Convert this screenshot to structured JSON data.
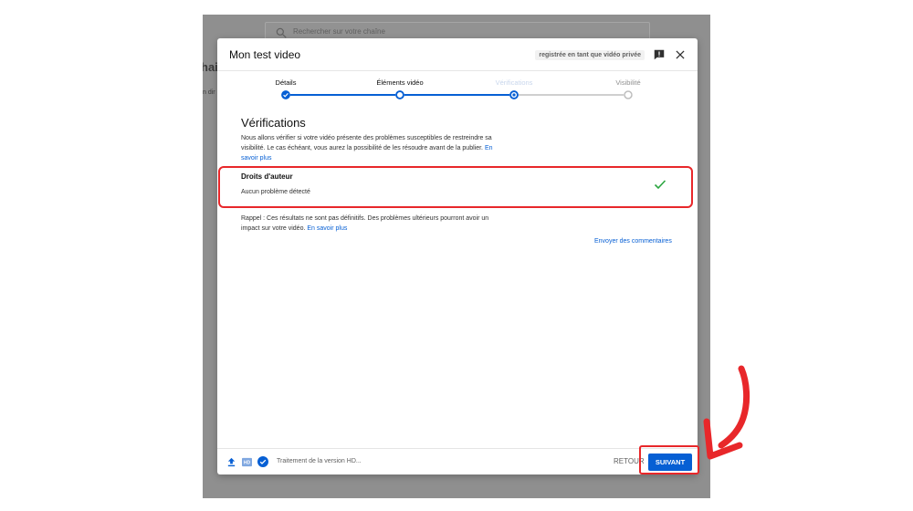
{
  "background": {
    "search_placeholder": "Rechercher sur votre chaîne",
    "page_title_partial": "hai",
    "page_sub_partial": "n dir"
  },
  "dialog": {
    "title": "Mon test video",
    "saved_status": "registrée en tant que vidéo privée",
    "icons": {
      "feedback": "feedback-icon",
      "close": "close-icon"
    }
  },
  "steps": [
    {
      "label": "Détails",
      "state": "done"
    },
    {
      "label": "Éléments vidéo",
      "state": "done"
    },
    {
      "label": "Vérifications",
      "state": "current"
    },
    {
      "label": "Visibilité",
      "state": "pending"
    }
  ],
  "checks": {
    "title": "Vérifications",
    "description": "Nous allons vérifier si votre vidéo présente des problèmes susceptibles de restreindre sa visibilité. Le cas échéant, vous aurez la possibilité de les résoudre avant de la publier.",
    "learn_more": "En savoir plus",
    "copyright": {
      "title": "Droits d'auteur",
      "status": "Aucun problème détecté"
    },
    "reminder": "Rappel : Ces résultats ne sont pas définitifs. Des problèmes ultérieurs pourront avoir un impact sur votre vidéo.",
    "reminder_link": "En savoir plus",
    "send_feedback": "Envoyer des commentaires"
  },
  "footer": {
    "processing": "Traitement de la version HD...",
    "back_label": "RETOUR",
    "next_label": "SUIVANT",
    "hd_badge": "HD"
  },
  "colors": {
    "accent": "#065fd4",
    "success": "#2ba640",
    "annotation": "#e8272a"
  }
}
